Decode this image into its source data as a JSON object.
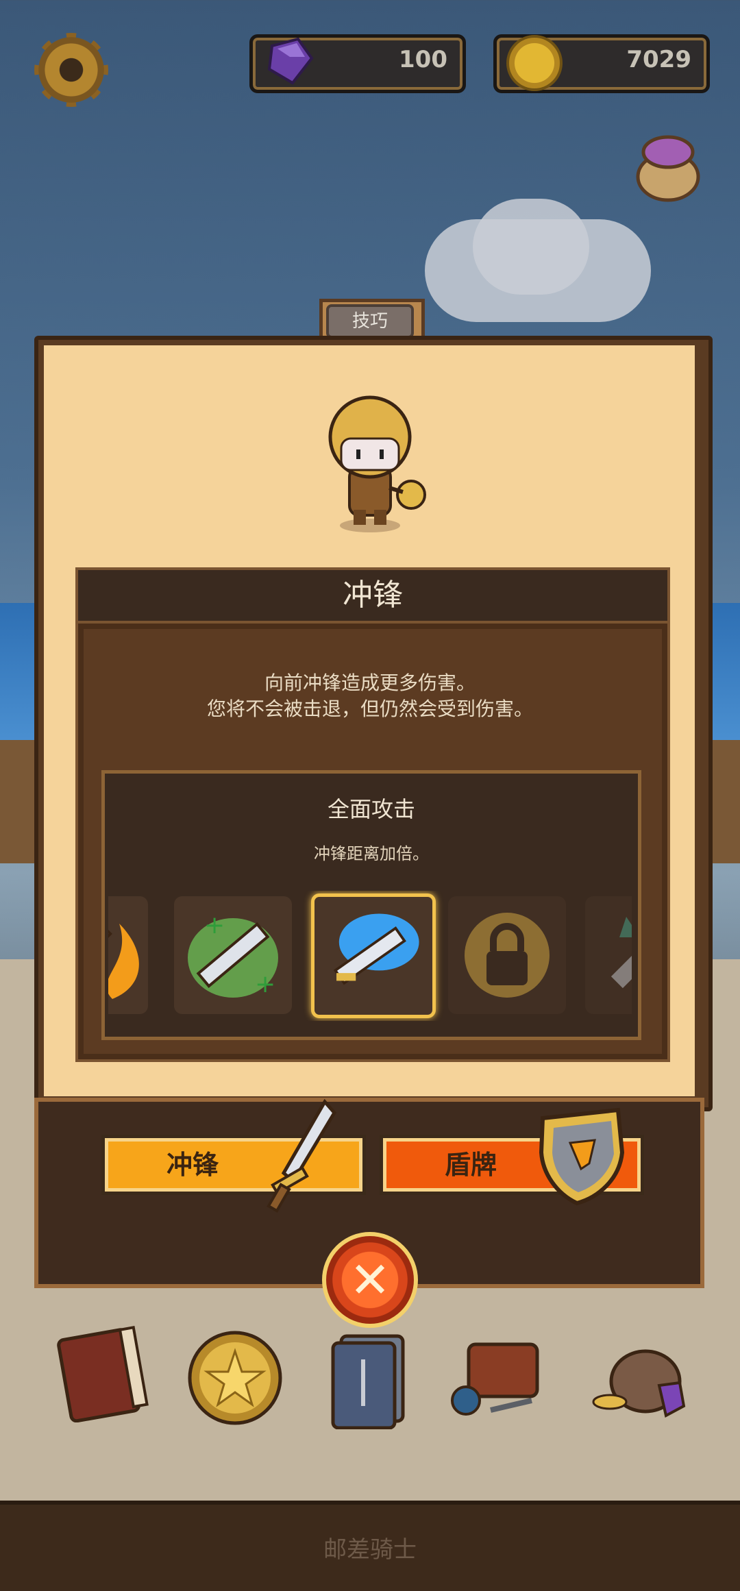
{
  "hud": {
    "gems": "100",
    "gold": "7029"
  },
  "panel": {
    "tab_label": "技巧",
    "skill_title": "冲锋",
    "skill_desc_line1": "向前冲锋造成更多伤害。",
    "skill_desc_line2": "您将不会被击退，但仍然会受到伤害。",
    "upgrade_title": "全面攻击",
    "upgrade_desc": "冲锋距离加倍。",
    "upgrades": [
      {
        "name": "fire-sword-icon",
        "state": "partial"
      },
      {
        "name": "heal-sword-icon",
        "state": "unlocked"
      },
      {
        "name": "dash-sword-icon",
        "state": "selected"
      },
      {
        "name": "explosion-sword-icon",
        "state": "locked"
      },
      {
        "name": "wind-sword-icon",
        "state": "partial"
      }
    ]
  },
  "actions": {
    "charge_label": "冲锋",
    "shield_label": "盾牌",
    "close_symbol": "✕"
  },
  "footer": {
    "game_title": "邮差骑士"
  },
  "colors": {
    "charge_button": "#f7a51a",
    "shield_button": "#f05a0c",
    "panel_bg": "#f5d39a",
    "selected_border": "#f2c24d"
  }
}
